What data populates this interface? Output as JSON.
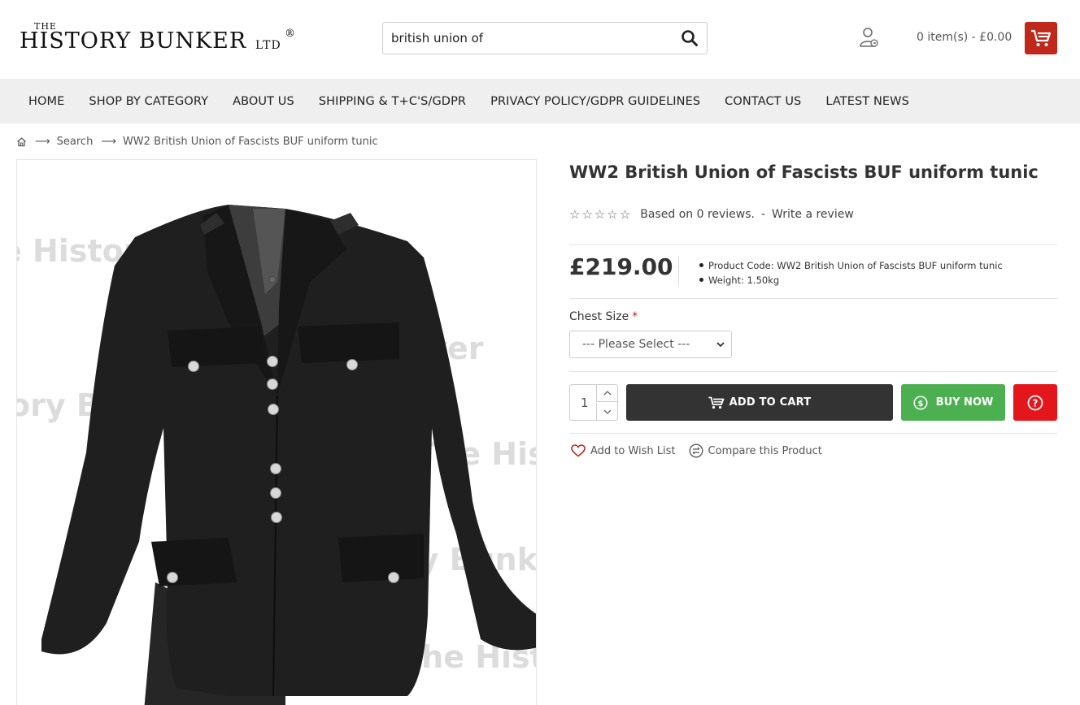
{
  "logo": {
    "the": "THE",
    "main": "HISTORY BUNKER",
    "ltd": "LTD",
    "reg": "®"
  },
  "search": {
    "value": "british union of",
    "button_icon": "search-icon"
  },
  "header": {
    "account_icon": "user-icon",
    "cart_total": "0 item(s) - £0.00",
    "cart_icon": "cart-icon",
    "accent": "#c0281c"
  },
  "nav": {
    "items": [
      "HOME",
      "SHOP BY CATEGORY",
      "ABOUT US",
      "SHIPPING & T+C'S/GDPR",
      "PRIVACY POLICY/GDPR GUIDELINES",
      "CONTACT US",
      "LATEST NEWS"
    ]
  },
  "breadcrumb": {
    "home_icon": "home-icon",
    "items": [
      "Search",
      "WW2 British Union of Fascists BUF uniform tunic"
    ]
  },
  "product": {
    "image_watermark": "© The History Bunker",
    "title": "WW2 British Union of Fascists BUF uniform tunic",
    "rating_text": "Based on 0 reviews.",
    "rating_dash": "-",
    "write_review": "Write a review",
    "rating_stars": 0,
    "price": "£219.00",
    "meta": {
      "code_label": "Product Code:",
      "code_value": "WW2 British Union of Fascists BUF uniform tunic",
      "weight_label": "Weight:",
      "weight_value": "1.50kg"
    },
    "option": {
      "label": "Chest Size",
      "required": "*",
      "selected": "--- Please Select ---"
    },
    "quantity": "1",
    "add_to_cart": "ADD TO CART",
    "buy_now": "BUY NOW",
    "wishlist": "Add to Wish List",
    "compare": "Compare this Product",
    "colors": {
      "add_cart_bg": "#333333",
      "buy_now_bg": "#4caf50",
      "question_bg": "#e3161c"
    }
  }
}
